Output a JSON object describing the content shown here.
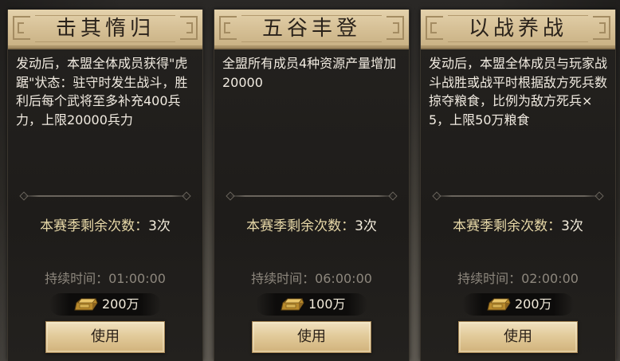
{
  "cards": [
    {
      "title": "击其惰归",
      "description": "发动后，本盟全体成员获得\"虎踞\"状态：驻守时发生战斗，胜利后每个武将至多补充400兵力，上限20000兵力",
      "remaining_label": "本赛季剩余次数：",
      "remaining_value": "3次",
      "duration": "持续时间：01:00:00",
      "cost": "200万",
      "cost_icon": "gold-ingot-icon",
      "use_label": "使用"
    },
    {
      "title": "五谷丰登",
      "description": "全盟所有成员4种资源产量增加20000",
      "remaining_label": "本赛季剩余次数：",
      "remaining_value": "3次",
      "duration": "持续时间：06:00:00",
      "cost": "100万",
      "cost_icon": "gold-ingot-icon",
      "use_label": "使用"
    },
    {
      "title": "以战养战",
      "description": "发动后，本盟全体成员与玩家战斗战胜或战平时根据敌方死兵数掠夺粮食，比例为敌方死兵×5，上限50万粮食",
      "remaining_label": "本赛季剩余次数：",
      "remaining_value": "3次",
      "duration": "持续时间：02:00:00",
      "cost": "200万",
      "cost_icon": "gold-ingot-icon",
      "use_label": "使用"
    }
  ],
  "colors": {
    "header_gold": "#d6c096",
    "remaining_text": "#e8d9a8",
    "duration_text": "#8d877d",
    "button_gold": "#e2cb9b"
  }
}
